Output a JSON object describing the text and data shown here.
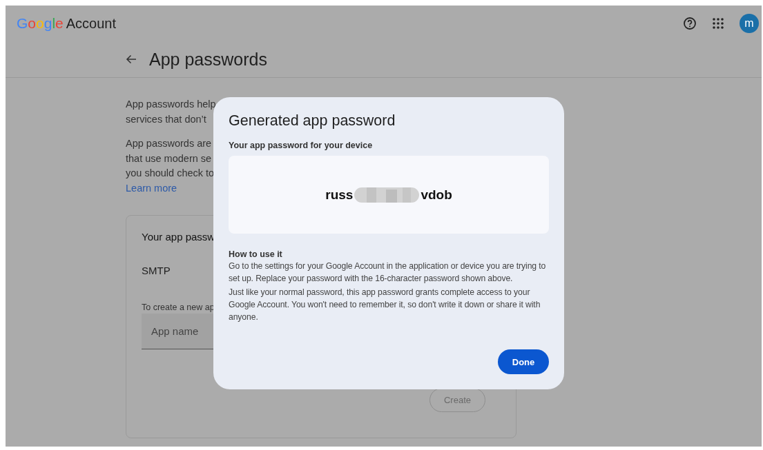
{
  "header": {
    "logo": "Google",
    "product": "Account",
    "avatar": "m"
  },
  "page": {
    "title": "App passwords",
    "intro_lines": [
      "App passwords help",
      "services that don’t"
    ],
    "detail_lines": [
      "App passwords are",
      "that use modern se",
      "you should check to"
    ],
    "link": "Learn more",
    "card": {
      "title": "Your app passw",
      "entries": [
        "SMTP"
      ],
      "hint": "To create a new ap",
      "field": {
        "placeholder": "App name"
      },
      "button": {
        "label": "Create",
        "disabled": true
      }
    }
  },
  "dialog": {
    "title": "Generated app password",
    "subtitle": "Your app password for your device",
    "password": {
      "start": "russ",
      "end": "vdob",
      "redacted": true
    },
    "howto_title": "How to use it",
    "paragraphs": [
      "Go to the settings for your Google Account in the application or device you are trying to set up. Replace your password with the 16-character password shown above.",
      "Just like your normal password, this app password grants complete access to your Google Account. You won't need to remember it, so don't write it down or share it with anyone."
    ],
    "button": "Done"
  }
}
